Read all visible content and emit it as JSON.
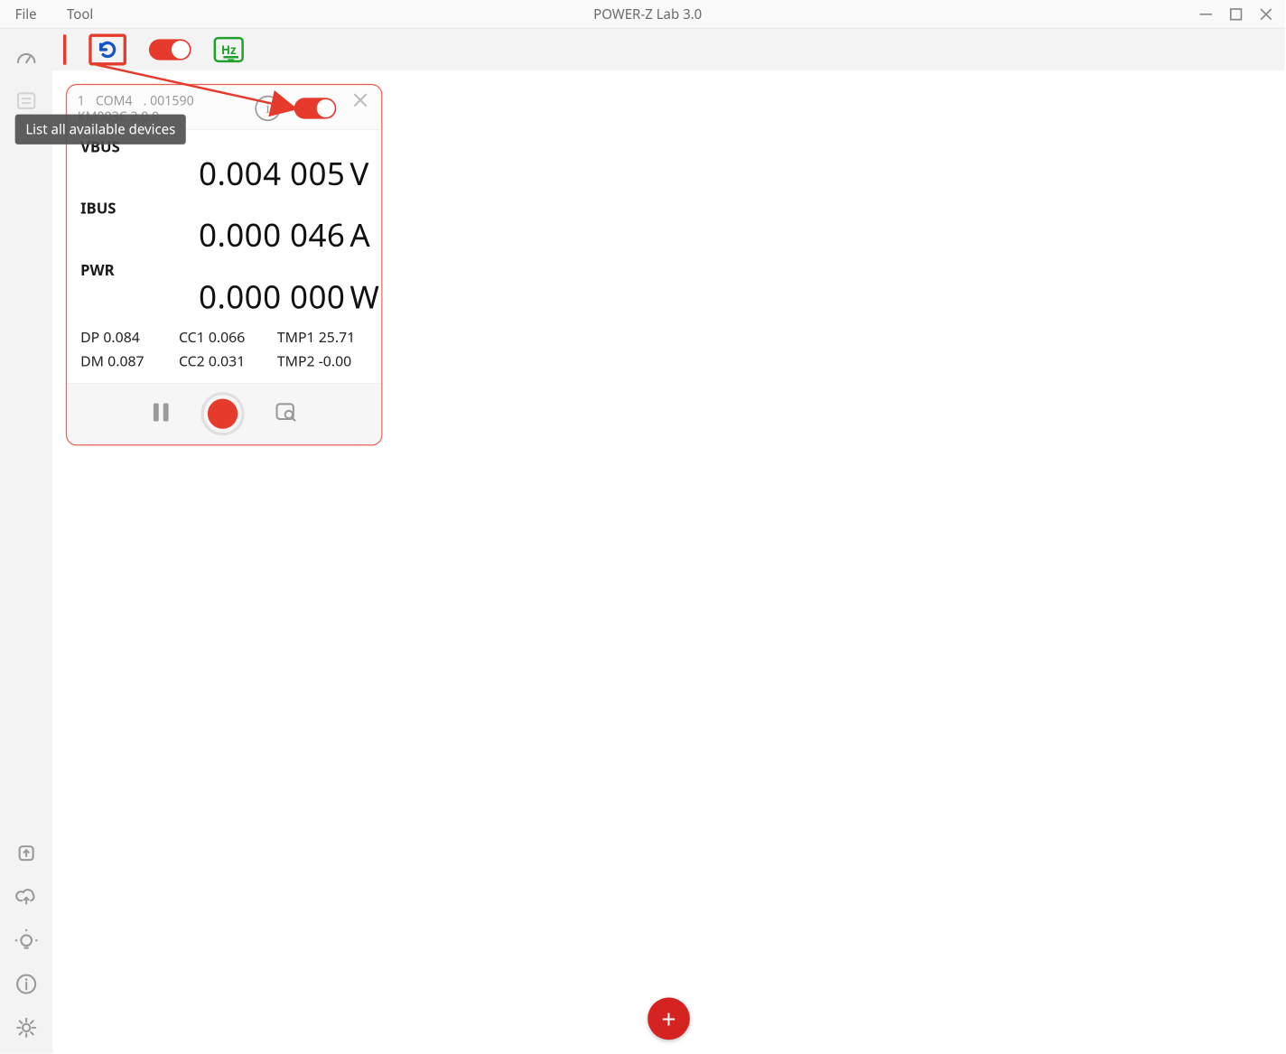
{
  "window": {
    "title": "POWER-Z Lab 3.0",
    "menu": {
      "file": "File",
      "tool": "Tool"
    }
  },
  "toolbar": {
    "hz_label": "Hz"
  },
  "tooltip": "List all available devices",
  "device_card": {
    "index": "1",
    "port": "COM4",
    "serial": ". 001590",
    "model": "KM003C 2.0.0",
    "measurements": {
      "vbus": {
        "label": "VBUS",
        "value": "0.004 005",
        "unit": "V"
      },
      "ibus": {
        "label": "IBUS",
        "value": "0.000 046",
        "unit": "A"
      },
      "pwr": {
        "label": "PWR",
        "value": "0.000 000",
        "unit": "W"
      }
    },
    "sub": {
      "dp": "DP 0.084",
      "cc1": "CC1 0.066",
      "tmp1": "TMP1 25.71",
      "dm": "DM 0.087",
      "cc2": "CC2 0.031",
      "tmp2": "TMP2 -0.00"
    }
  },
  "colors": {
    "accent": "#e63a2d",
    "green": "#21a12c",
    "blue": "#1555c2"
  }
}
